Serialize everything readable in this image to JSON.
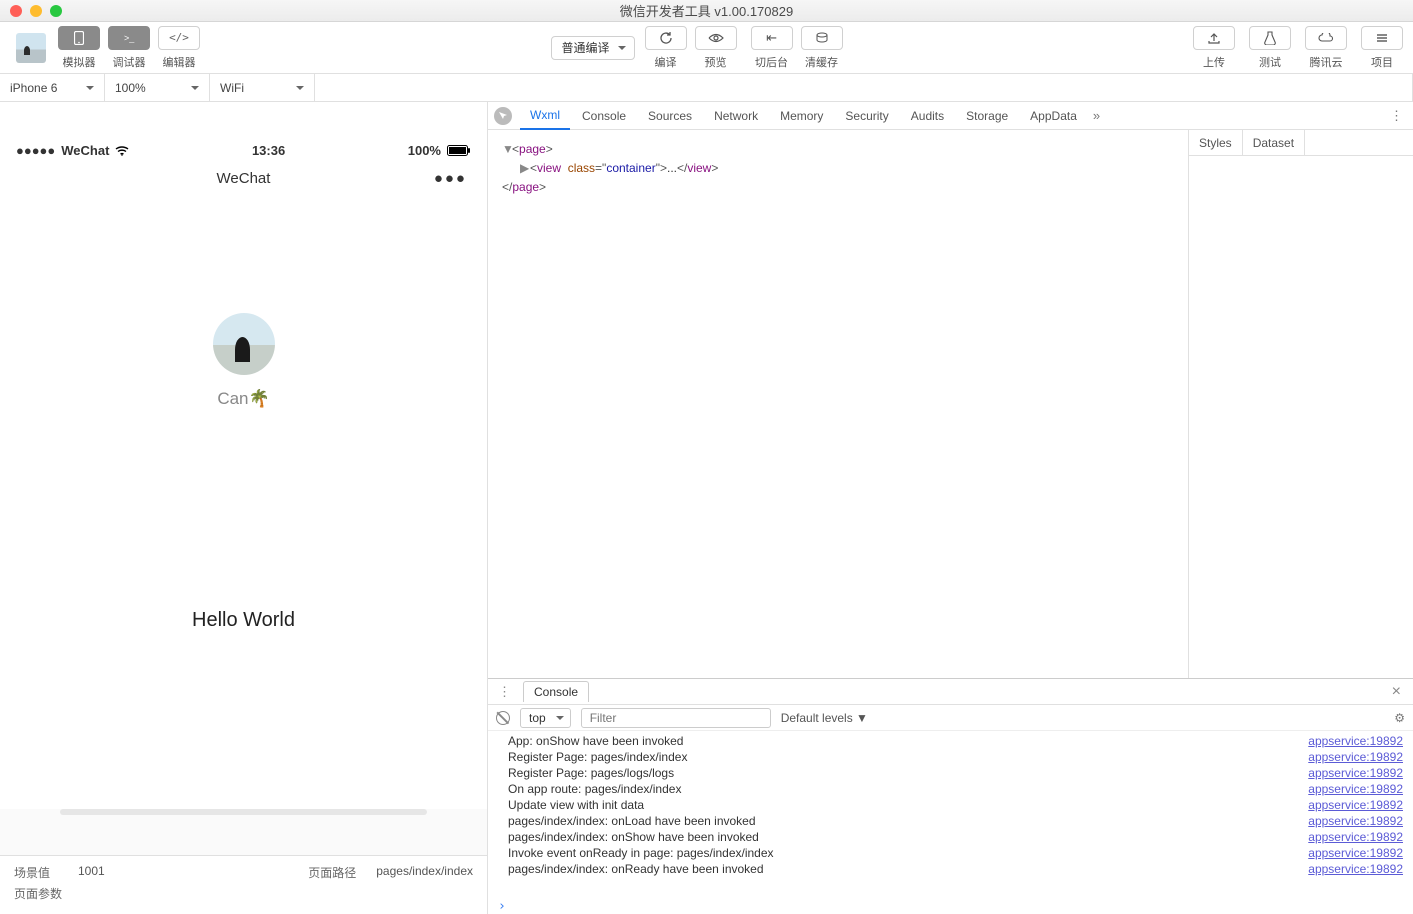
{
  "window_title": "微信开发者工具 v1.00.170829",
  "toolbar": {
    "buttons": {
      "simulator": "模拟器",
      "debugger": "调试器",
      "editor": "编辑器",
      "compile": "编译",
      "preview": "预览",
      "background": "切后台",
      "clear_cache": "清缓存",
      "upload": "上传",
      "test": "测试",
      "tencent_cloud": "腾讯云",
      "project": "项目"
    },
    "compile_mode": "普通编译"
  },
  "sim_opts": {
    "device": "iPhone 6",
    "zoom": "100%",
    "network": "WiFi"
  },
  "phone": {
    "carrier": "WeChat",
    "time": "13:36",
    "battery": "100%",
    "nav_title": "WeChat",
    "username": "Can🌴",
    "hello": "Hello World"
  },
  "sim_footer": {
    "scene_label": "场景值",
    "scene_value": "1001",
    "path_label": "页面路径",
    "path_value": "pages/index/index",
    "params_label": "页面参数"
  },
  "devtools": {
    "tabs": [
      "Wxml",
      "Console",
      "Sources",
      "Network",
      "Memory",
      "Security",
      "Audits",
      "Storage",
      "AppData"
    ],
    "active_tab": "Wxml",
    "side_tabs": [
      "Styles",
      "Dataset"
    ],
    "wxml": {
      "root_open": "page",
      "child_tag": "view",
      "child_attr": "class",
      "child_val": "container",
      "ellipsis": "...",
      "root_close": "page"
    }
  },
  "drawer": {
    "tab": "Console",
    "context": "top",
    "filter_placeholder": "Filter",
    "levels": "Default levels ▼",
    "lines": [
      "App: onShow have been invoked",
      "Register Page: pages/index/index",
      "Register Page: pages/logs/logs",
      "On app route: pages/index/index",
      "Update view with init data",
      "pages/index/index: onLoad have been invoked",
      "pages/index/index: onShow have been invoked",
      "Invoke event onReady in page: pages/index/index",
      "pages/index/index: onReady have been invoked"
    ],
    "source": "appservice:19892"
  }
}
